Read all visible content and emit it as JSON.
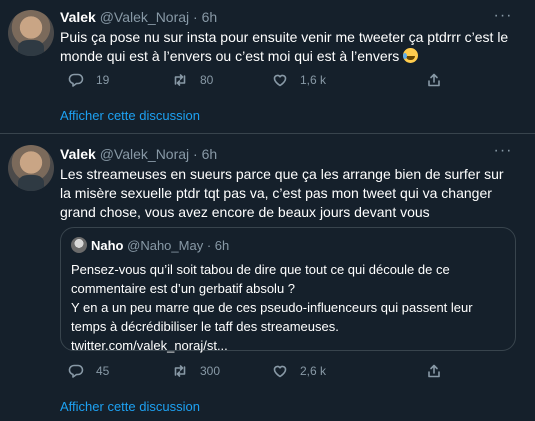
{
  "tweets": [
    {
      "name": "Valek",
      "handle": "@Valek_Noraj",
      "separator": "·",
      "time": "6h",
      "text": "Puis ça pose nu sur insta pour ensuite venir me tweeter ça ptdrrr c’est le monde qui est à l’envers ou c’est moi qui est à l’envers",
      "emoji": "tears-of-joy",
      "replies": "19",
      "retweets": "80",
      "likes": "1,6 k",
      "show_thread": "Afficher cette discussion"
    },
    {
      "name": "Valek",
      "handle": "@Valek_Noraj",
      "separator": "·",
      "time": "6h",
      "text": "Les streameuses en sueurs parce que ça les arrange bien de surfer sur la misère sexuelle ptdr tqt pas va, c’est pas mon tweet qui va changer grand chose, vous avez encore de beaux jours devant vous",
      "quote": {
        "name": "Naho",
        "handle": "@Naho_May",
        "separator": "·",
        "time": "6h",
        "text_line1": "Pensez-vous qu’il soit tabou de dire que tout ce qui découle de ce commentaire est d’un gerbatif absolu ?",
        "text_line2": "Y en a un peu marre que de ces pseudo-influenceurs qui passent leur temps à décrédibiliser le taff des streameuses.",
        "link": "twitter.com/valek_noraj/st..."
      },
      "replies": "45",
      "retweets": "300",
      "likes": "2,6 k",
      "show_thread": "Afficher cette discussion"
    }
  ],
  "icons": {
    "more": "more-horizontal-icon",
    "reply": "reply-icon",
    "retweet": "retweet-icon",
    "like": "heart-icon",
    "share": "share-icon"
  },
  "colors": {
    "background": "#15202b",
    "border": "#38444d",
    "secondary_text": "#8899a6",
    "link": "#1da1f2"
  }
}
